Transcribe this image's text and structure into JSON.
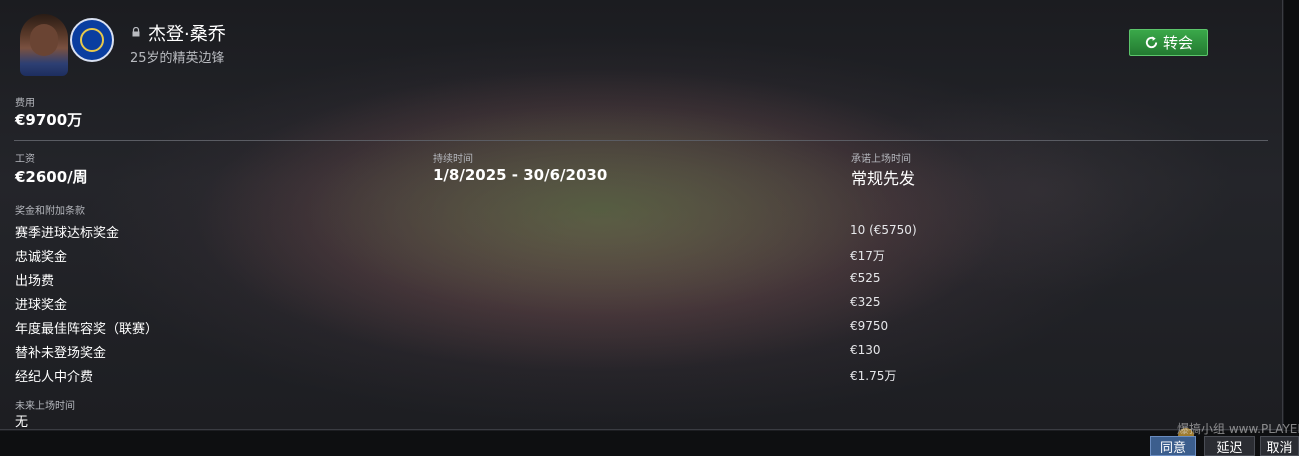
{
  "player": {
    "name": "杰登·桑乔",
    "description": "25岁的精英边锋"
  },
  "header": {
    "transfer_button": "转会"
  },
  "fee": {
    "label": "费用",
    "value": "€9700万"
  },
  "wage": {
    "label": "工资",
    "value": "€2600/周"
  },
  "duration": {
    "label": "持续时间",
    "value": "1/8/2025 - 30/6/2030"
  },
  "playing_time": {
    "label": "承诺上场时间",
    "value": "常规先发"
  },
  "bonuses": {
    "label": "奖金和附加条款",
    "items": [
      {
        "name": "赛季进球达标奖金",
        "value": "10 (€5750)"
      },
      {
        "name": "忠诚奖金",
        "value": "€17万"
      },
      {
        "name": "出场费",
        "value": "€525"
      },
      {
        "name": "进球奖金",
        "value": "€325"
      },
      {
        "name": "年度最佳阵容奖（联赛）",
        "value": "€9750"
      },
      {
        "name": "替补未登场奖金",
        "value": "€130"
      },
      {
        "name": "经纪人中介费",
        "value": "€1.75万"
      }
    ]
  },
  "future_playing_time": {
    "label": "未来上场时间",
    "value": "无"
  },
  "actions": {
    "agree": "同意",
    "delay": "延迟",
    "cancel": "取消"
  },
  "watermark": {
    "text": "爆搞小组 www.PLAYER.CN"
  },
  "colors": {
    "transfer_green": "#2e9a3f",
    "agree_blue": "#3c5e8d",
    "badge_blue": "#0a3ea0"
  },
  "icons": {
    "lock": "lock-icon",
    "refresh": "refresh-icon",
    "club": "chelsea-badge-icon"
  }
}
